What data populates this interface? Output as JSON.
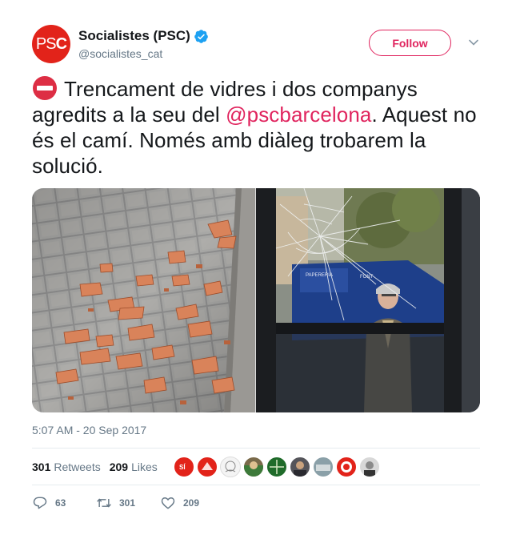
{
  "account": {
    "display_name": "Socialistes (PSC)",
    "handle": "@socialistes_cat",
    "avatar_text_left": "PS",
    "avatar_text_right": "C",
    "verified": true
  },
  "follow_label": "Follow",
  "tweet": {
    "text_before": "Trencament de vidres i dos companys agredits a la seu del ",
    "mention": "@pscbarcelona",
    "text_after": ". Aquest no és el camí. Només amb diàleg trobarem la solució."
  },
  "media": {
    "left_photo": "broken-tiles-on-sidewalk",
    "right_photo": "shattered-glass-door-with-man",
    "sign_text_1": "PAPERERIA",
    "sign_text_2": "FONT"
  },
  "timestamp": "5:07 AM - 20 Sep 2017",
  "stats": {
    "retweets_count": "301",
    "retweets_label": "Retweets",
    "likes_count": "209",
    "likes_label": "Likes"
  },
  "likers_avatar_1_text": "SÍ",
  "actions": {
    "reply_count": "63",
    "retweet_count": "301",
    "like_count": "209"
  },
  "colors": {
    "accent": "#e0245e",
    "verified": "#1da1f2",
    "psc_red": "#e2231a",
    "secondary_text": "#657786"
  }
}
